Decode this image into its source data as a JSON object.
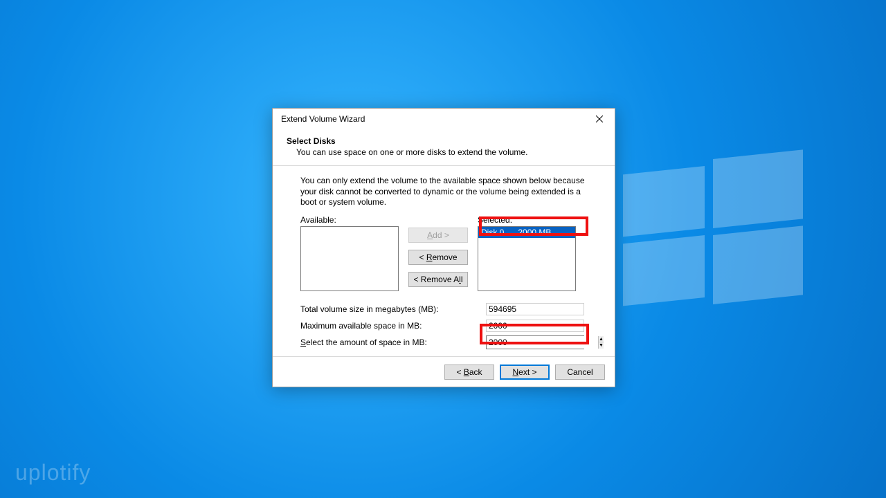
{
  "watermark": "uplotify",
  "dialog": {
    "title": "Extend Volume Wizard",
    "heading": "Select Disks",
    "subheading": "You can use space on one or more disks to extend the volume.",
    "info": "You can only extend the volume to the available space shown below because your disk cannot be converted to dynamic or the volume being extended is a boot or system volume.",
    "available_label": "Available:",
    "selected_label": "Selected:",
    "selected_item": "Disk 0      2000 MB",
    "buttons": {
      "add": "Add >",
      "remove": "< Remove",
      "remove_all": "< Remove All",
      "back": "< Back",
      "next": "Next >",
      "cancel": "Cancel"
    },
    "mnemonics": {
      "add": "A",
      "remove": "R",
      "remove_all": "R",
      "select_amount": "S",
      "back": "B",
      "next": "N"
    },
    "fields": {
      "total_label": "Total volume size in megabytes (MB):",
      "total_value": "594695",
      "max_label": "Maximum available space in MB:",
      "max_value": "2000",
      "amount_label": "Select the amount of space in MB:",
      "amount_value": "2000"
    }
  }
}
